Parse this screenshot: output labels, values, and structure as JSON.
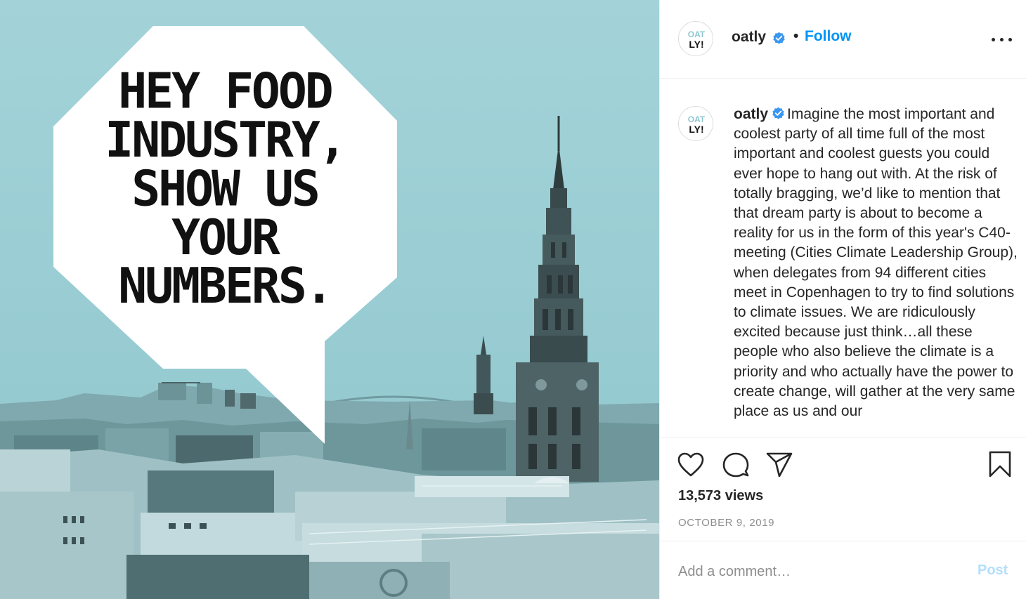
{
  "post": {
    "image": {
      "bubble_text": [
        "HEY FOOD",
        "INDUSTRY,",
        "SHOW US",
        "YOUR",
        "NUMBERS."
      ],
      "bg_color": "#9ccfd6"
    },
    "header": {
      "username": "oatly",
      "separator": "•",
      "follow_label": "Follow",
      "verified_icon": "verified-badge-icon",
      "more_icon": "more-options-icon"
    },
    "avatar": {
      "logo_lines": [
        "OAT",
        "LY!"
      ],
      "icon": "oatly-logo-avatar"
    },
    "caption": {
      "username": "oatly",
      "text": "Imagine the most important and coolest party of all time full of the most important and coolest guests you could ever hope to hang out with. At the risk of totally bragging, we’d like to mention that that dream party is about to become a reality for us in the form of this year's C40-meeting (Cities Climate Leadership Group), when delegates from 94 different cities meet in Copenhagen to try to find solutions to climate issues. We are ridiculously excited because just think…all these people who also believe the climate is a priority and who actually have the power to create change, will gather at the very same place as us and our"
    },
    "actions": {
      "like_icon": "heart-icon",
      "comment_icon": "comment-icon",
      "share_icon": "share-icon",
      "save_icon": "bookmark-icon"
    },
    "stats": {
      "views": "13,573 views",
      "date": "OCTOBER 9, 2019"
    },
    "comment": {
      "placeholder": "Add a comment…",
      "post_label": "Post"
    },
    "colors": {
      "link_blue": "#0095f6",
      "post_disabled": "#b2dffc",
      "muted": "#8e8e8e",
      "text": "#262626"
    }
  }
}
